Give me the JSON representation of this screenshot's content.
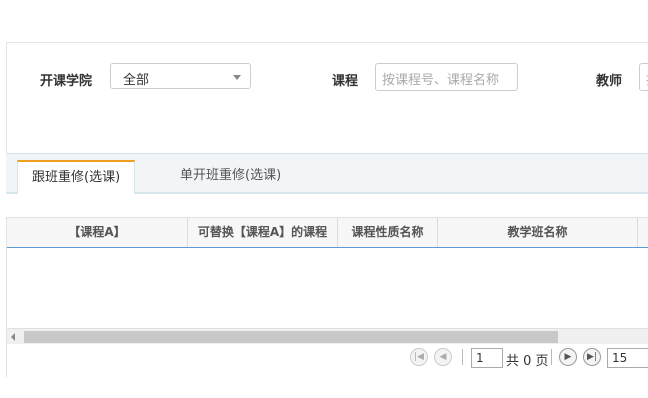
{
  "filters": {
    "college_label": "开课学院",
    "college_value": "全部",
    "course_label": "课程",
    "course_placeholder": "按课程号、课程名称",
    "teacher_label": "教师",
    "teacher_placeholder": "按"
  },
  "tabs": [
    {
      "label": "跟班重修(选课)",
      "active": true
    },
    {
      "label": "单开班重修(选课)",
      "active": false
    }
  ],
  "grid": {
    "columns": [
      "【课程A】",
      "可替换【课程A】的课程",
      "课程性质名称",
      "教学班名称"
    ],
    "rows": []
  },
  "pager": {
    "first_icon": "first-page-icon",
    "prev_icon": "prev-page-icon",
    "next_icon": "next-page-icon",
    "last_icon": "last-page-icon",
    "current_page": "1",
    "total_pages_text": "共 0 页",
    "page_size": "15"
  }
}
